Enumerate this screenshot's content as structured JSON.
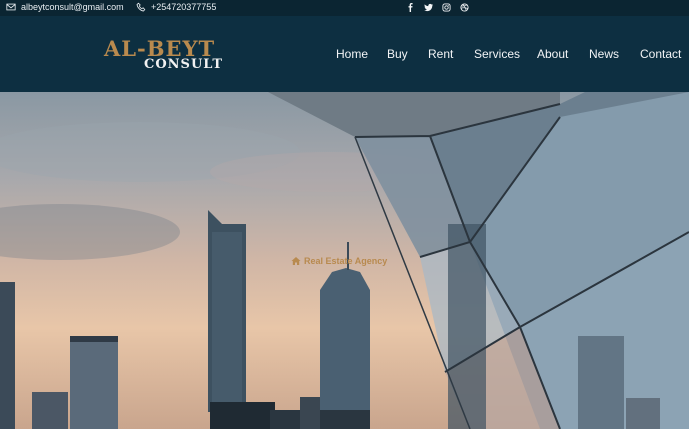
{
  "topbar": {
    "email": "albeytconsult@gmail.com",
    "phone": "+254720377755",
    "social_icons": [
      "facebook-icon",
      "twitter-icon",
      "instagram-icon",
      "dribbble-icon"
    ]
  },
  "brand": {
    "line1": "AL-BEYT",
    "line2": "CONSULT"
  },
  "nav": {
    "items": [
      "Home",
      "Buy",
      "Rent",
      "Services",
      "About",
      "News",
      "Contact"
    ]
  },
  "hero": {
    "tag": "Real Estate Agency"
  },
  "colors": {
    "topbar_bg": "#0b2532",
    "header_bg": "#0d2f41",
    "accent": "#b98a4e"
  }
}
